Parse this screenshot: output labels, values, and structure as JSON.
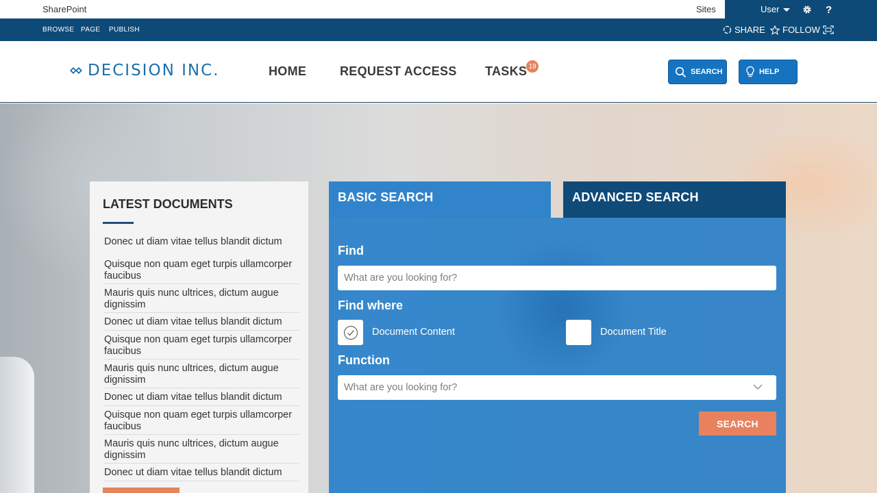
{
  "suitebar": {
    "brand": "SharePoint",
    "sites": "Sites",
    "user": "User",
    "help_icon_text": "?"
  },
  "ribbon": {
    "tabs": [
      "BROWSE",
      "PAGE",
      "PUBLISH"
    ],
    "share": "SHARE",
    "follow": "FOLLOW"
  },
  "header": {
    "logo_text": "DECISION INC.",
    "nav": [
      "HOME",
      "REQUEST ACCESS",
      "TASKS"
    ],
    "tasks_badge": "19",
    "search_button": "SEARCH",
    "help_button": "HELP"
  },
  "latest": {
    "title": "LATEST DOCUMENTS",
    "items": [
      "Donec ut diam vitae tellus blandit dictum",
      "Quisque non quam eget turpis ullamcorper faucibus",
      "Mauris quis nunc ultrices, dictum augue dignissim",
      "Donec ut diam vitae tellus blandit dictum",
      "Quisque non quam eget turpis ullamcorper faucibus",
      "Mauris quis nunc ultrices, dictum augue dignissim",
      "Donec ut diam vitae tellus blandit dictum",
      "Quisque non quam eget turpis ullamcorper faucibus",
      "Mauris quis nunc ultrices, dictum augue dignissim",
      "Donec ut diam vitae tellus blandit dictum"
    ]
  },
  "search": {
    "tab_basic": "BASIC SEARCH",
    "tab_advanced": "ADVANCED SEARCH",
    "find_label": "Find",
    "find_placeholder": "What are you looking for?",
    "where_label": "Find where",
    "option_content": "Document Content",
    "option_content_checked": true,
    "option_title": "Document Title",
    "option_title_checked": false,
    "function_label": "Function",
    "function_placeholder": "What are you looking for?",
    "submit": "SEARCH"
  },
  "colors": {
    "ribbon": "#0e4a78",
    "accent_blue": "#1573c0",
    "accent_orange": "#e8825e"
  }
}
